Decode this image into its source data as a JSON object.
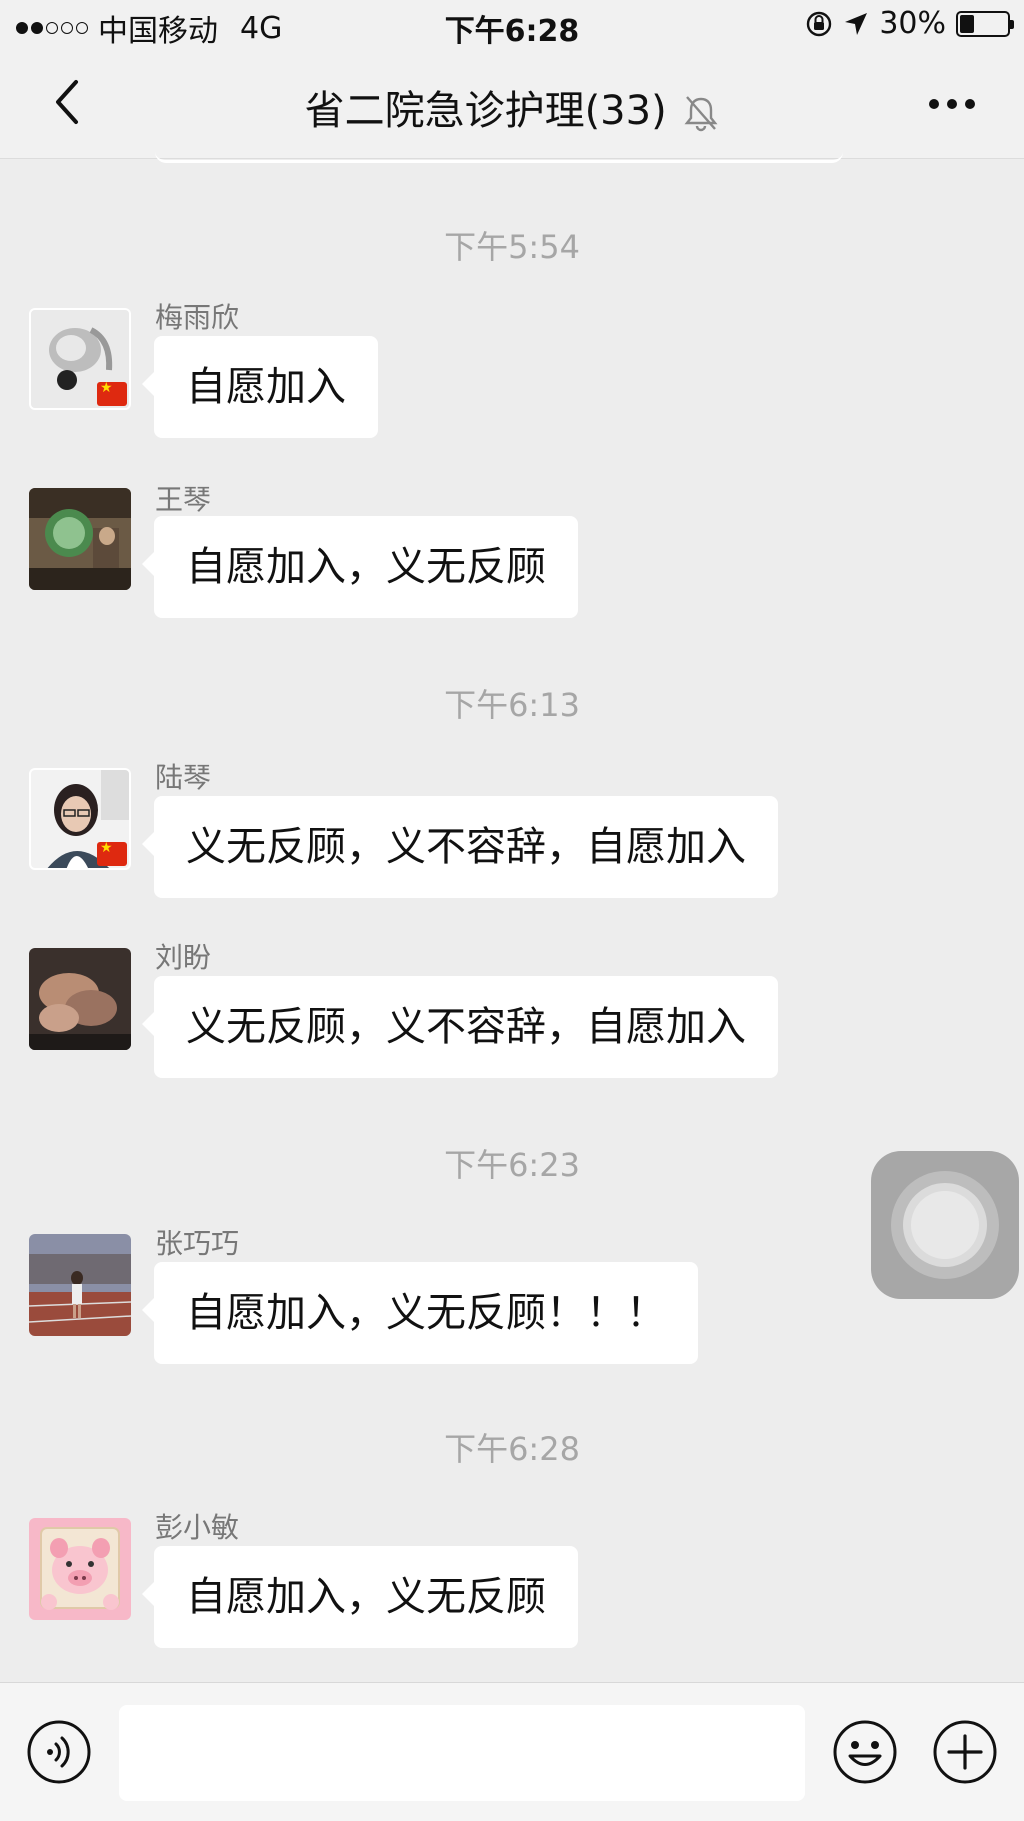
{
  "status_bar": {
    "carrier": "中国移动",
    "network": "4G",
    "time": "下午6:28",
    "battery": "30%",
    "battery_level": 0.3
  },
  "nav": {
    "title": "省二院急诊护理(33)",
    "back_icon": "chevron-left-icon",
    "mute_icon": "bell-off-icon",
    "more_icon": "more-dots-icon"
  },
  "chat": {
    "timestamps": [
      "下午5:54",
      "下午6:13",
      "下午6:23",
      "下午6:28"
    ],
    "messages": [
      {
        "sender": "梅雨欣",
        "text": "自愿加入",
        "avatar": "avatar-baby-photo"
      },
      {
        "sender": "王琴",
        "text": "自愿加入，义无反顾",
        "avatar": "avatar-room-photo"
      },
      {
        "sender": "陆琴",
        "text": "义无反顾，义不容辞，自愿加入",
        "avatar": "avatar-woman-photo"
      },
      {
        "sender": "刘盼",
        "text": "义无反顾，义不容辞，自愿加入",
        "avatar": "avatar-hands-photo"
      },
      {
        "sender": "张巧巧",
        "text": "自愿加入，义无反顾！！！",
        "avatar": "avatar-track-photo"
      },
      {
        "sender": "彭小敏",
        "text": "自愿加入，义无反顾",
        "avatar": "avatar-pig-cartoon"
      }
    ]
  },
  "input_bar": {
    "placeholder": "",
    "voice_icon": "voice-icon",
    "emoji_icon": "emoji-icon",
    "plus_icon": "plus-icon"
  },
  "colors": {
    "background": "#ededed",
    "bubble": "#ffffff",
    "timestamp": "#a6a6a6",
    "sender": "#777777"
  }
}
